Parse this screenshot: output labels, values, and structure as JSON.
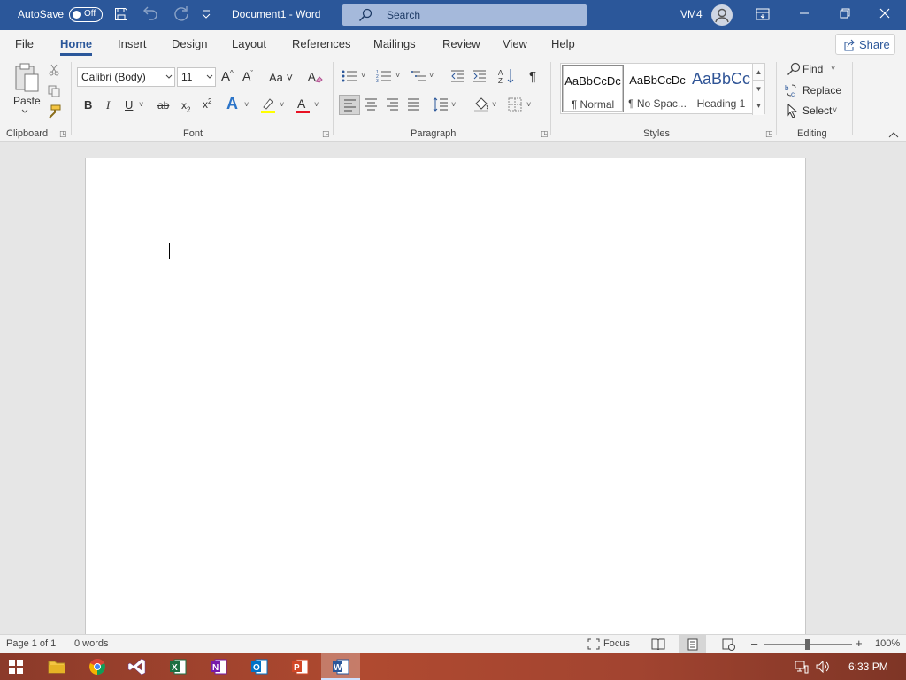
{
  "titlebar": {
    "autosave_label": "AutoSave",
    "autosave_state": "Off",
    "document_title": "Document1  -  Word",
    "search_placeholder": "Search",
    "user_initials": "VM4"
  },
  "tabs": [
    {
      "label": "File"
    },
    {
      "label": "Home",
      "active": true
    },
    {
      "label": "Insert"
    },
    {
      "label": "Design"
    },
    {
      "label": "Layout"
    },
    {
      "label": "References"
    },
    {
      "label": "Mailings"
    },
    {
      "label": "Review"
    },
    {
      "label": "View"
    },
    {
      "label": "Help"
    }
  ],
  "share_label": "Share",
  "ribbon": {
    "clipboard": {
      "group_label": "Clipboard",
      "paste_label": "Paste"
    },
    "font": {
      "group_label": "Font",
      "font_name": "Calibri (Body)",
      "font_size": "11",
      "change_case": "Aa"
    },
    "paragraph": {
      "group_label": "Paragraph"
    },
    "styles": {
      "group_label": "Styles",
      "items": [
        {
          "sample": "AaBbCcDc",
          "name": "¶ Normal"
        },
        {
          "sample": "AaBbCcDc",
          "name": "¶ No Spac..."
        },
        {
          "sample": "AaBbCc",
          "name": "Heading 1"
        }
      ]
    },
    "editing": {
      "group_label": "Editing",
      "find": "Find",
      "replace": "Replace",
      "select": "Select"
    }
  },
  "status": {
    "page": "Page 1 of 1",
    "words": "0 words",
    "focus": "Focus",
    "zoom_percent": "100%"
  },
  "taskbar": {
    "time": "6:33 PM"
  },
  "colors": {
    "word_blue": "#2b579a",
    "highlight_yellow": "#ffff00",
    "font_red": "#e81123"
  }
}
